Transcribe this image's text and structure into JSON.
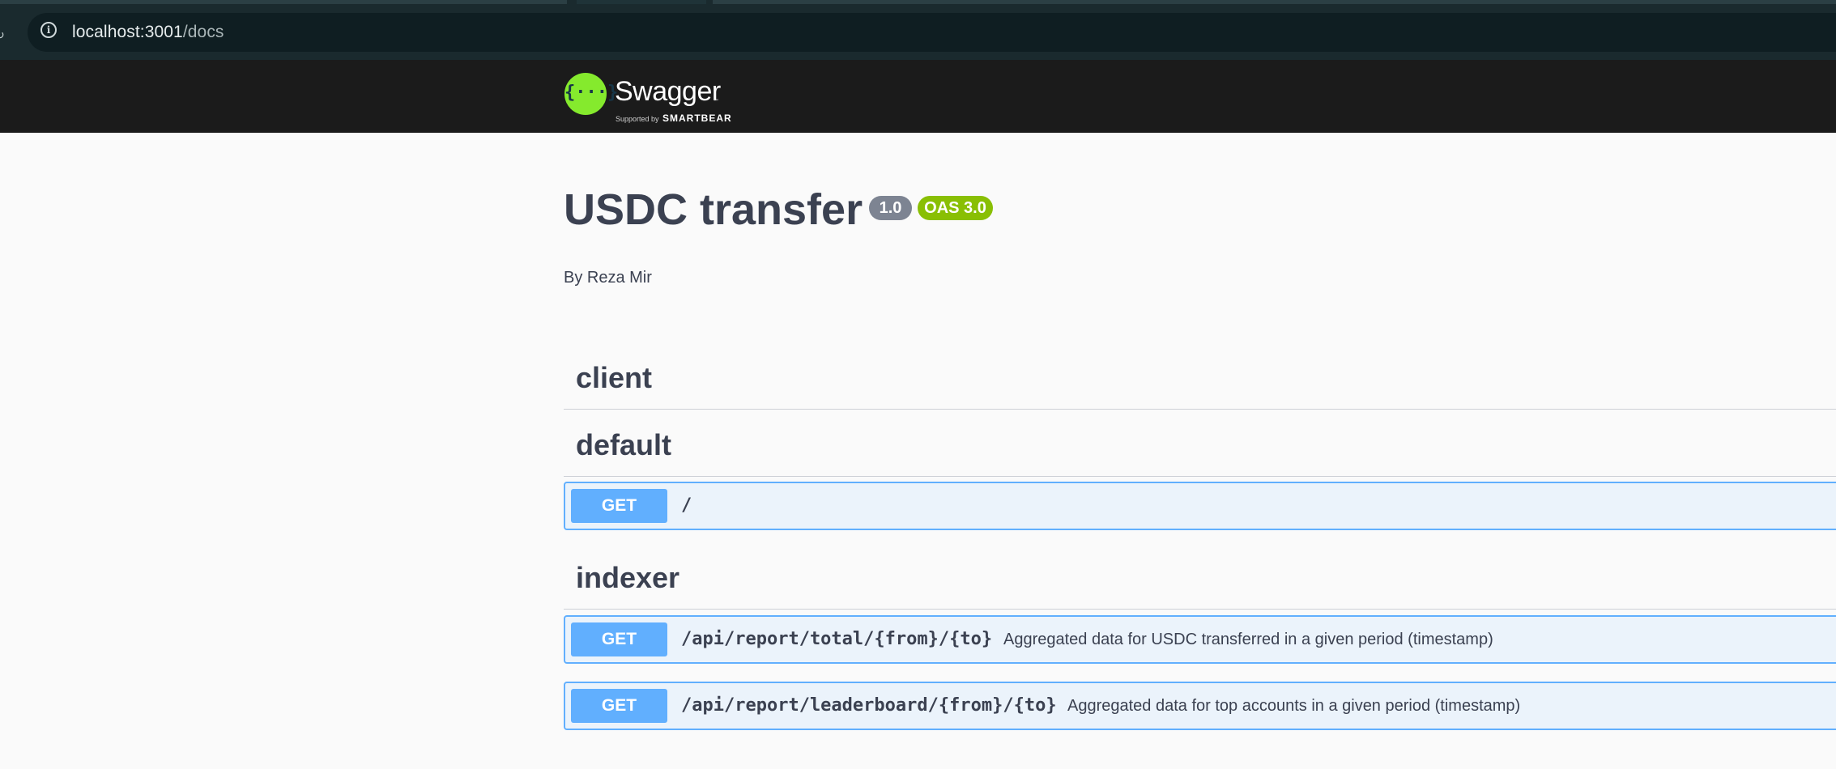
{
  "browser": {
    "url_host": "localhost:3001",
    "url_path": "/docs"
  },
  "topbar": {
    "logo_icon": "{···}",
    "logo_word": "Swagger",
    "logo_tm": "™",
    "supported_by": "Supported by",
    "brand": "SMARTBEAR"
  },
  "info": {
    "title": "USDC transfer",
    "version": "1.0",
    "oas": "OAS 3.0",
    "author": "By Reza Mir"
  },
  "tags": [
    {
      "name": "client",
      "operations": []
    },
    {
      "name": "default",
      "operations": [
        {
          "method": "GET",
          "path": "/",
          "summary": ""
        }
      ]
    },
    {
      "name": "indexer",
      "operations": [
        {
          "method": "GET",
          "path": "/api/report/total/{from}/{to}",
          "summary": "Aggregated data for USDC transferred in a given period (timestamp)"
        },
        {
          "method": "GET",
          "path": "/api/report/leaderboard/{from}/{to}",
          "summary": "Aggregated data for top accounts in a given period (timestamp)"
        }
      ]
    }
  ],
  "colors": {
    "get": "#61affe",
    "get_bg": "#ebf3fb",
    "logo_green": "#85ea2d",
    "oas_badge": "#89bf04",
    "version_badge": "#7d8492"
  }
}
